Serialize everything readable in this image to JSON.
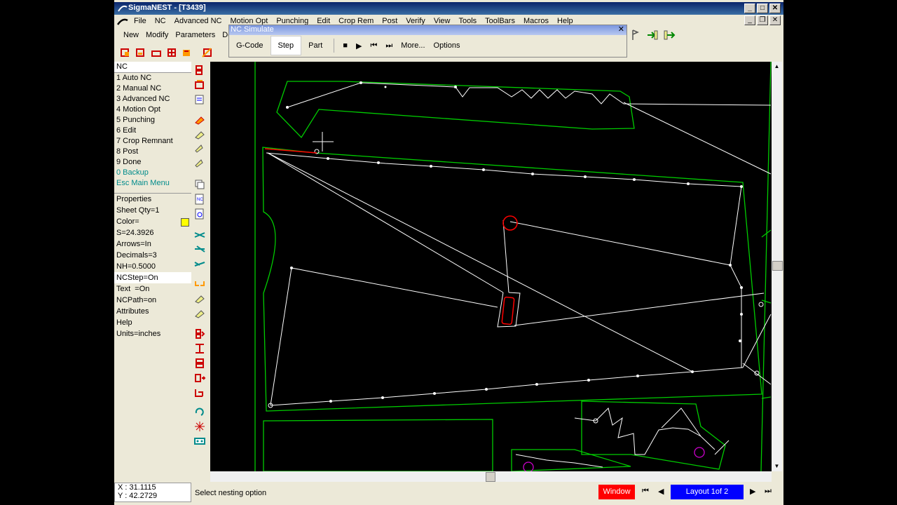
{
  "window": {
    "title": "SigmaNEST - [T3439]"
  },
  "menubar": [
    "File",
    "NC",
    "Advanced NC",
    "Motion Opt",
    "Punching",
    "Edit",
    "Crop Rem",
    "Post",
    "Verify",
    "View",
    "Tools",
    "ToolBars",
    "Macros",
    "Help"
  ],
  "toolbar1": [
    "New",
    "Modify",
    "Parameters",
    "De"
  ],
  "nc_simulate": {
    "title": "NC Simulate",
    "tabs": [
      "G-Code",
      "Step",
      "Part"
    ],
    "selected_tab": "Step",
    "more": "More...",
    "options": "Options"
  },
  "nc_menu": {
    "header": "NC",
    "items": [
      "1 Auto NC",
      "2 Manual NC",
      "3 Advanced NC",
      "4 Motion Opt",
      "5 Punching",
      "6 Edit",
      "7 Crop Remnant",
      "8 Post",
      "9 Done"
    ],
    "backup": "0 Backup",
    "main_menu": "Esc Main Menu"
  },
  "properties": {
    "header": "Properties",
    "items": [
      "Sheet Qty=1",
      "Color=",
      "S=24.3926",
      "Arrows=In",
      "Decimals=3",
      "NH=0.5000",
      "NCStep=On",
      "Text  =On",
      "NCPath=on",
      "Attributes",
      "Help",
      "Units=inches"
    ],
    "highlighted_index": 6,
    "color_swatch": "#ffff00"
  },
  "status": {
    "x": "X : 31.1115",
    "y": "Y : 42.2729",
    "message": "Select nesting option",
    "window_btn": "Window",
    "layout": "Layout 1of 2"
  },
  "colors": {
    "part_outline": "#00cc00",
    "tool_path": "#ffffff",
    "highlight": "#ff0000",
    "marker": "#cc00cc"
  }
}
